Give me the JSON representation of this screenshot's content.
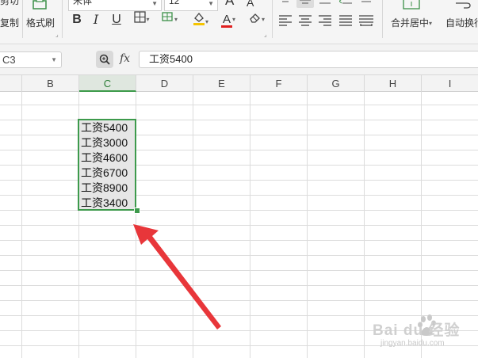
{
  "ribbon": {
    "cut_label": "剪切",
    "copy_label": "复制",
    "format_painter_label": "格式刷",
    "font_name": "宋体",
    "font_size": "12",
    "bold_label": "B",
    "italic_label": "I",
    "underline_label": "U",
    "font_color_label": "A",
    "grow_font_label": "A",
    "shrink_font_label": "A",
    "merge_center_label": "合并居中",
    "wrap_text_label": "自动换行"
  },
  "formula_bar": {
    "name_box": "C3",
    "fx_label": "fx",
    "formula_value": "工资5400"
  },
  "columns": [
    "B",
    "C",
    "D",
    "E",
    "F",
    "G",
    "H",
    "I"
  ],
  "active_column": "C",
  "cells": [
    {
      "col": "C",
      "value": "工资5400"
    },
    {
      "col": "C",
      "value": "工资3000"
    },
    {
      "col": "C",
      "value": "工资4600"
    },
    {
      "col": "C",
      "value": "工资6700"
    },
    {
      "col": "C",
      "value": "工资8900"
    },
    {
      "col": "C",
      "value": "工资3400"
    }
  ],
  "colors": {
    "selection": "#3d9a4c",
    "arrow": "#e8363a",
    "font_color_bar": "#e02020",
    "fill_color_bar": "#f5c400"
  },
  "watermark": {
    "line1": "Bai du 经验",
    "line2": "jingyan.baidu.com"
  }
}
